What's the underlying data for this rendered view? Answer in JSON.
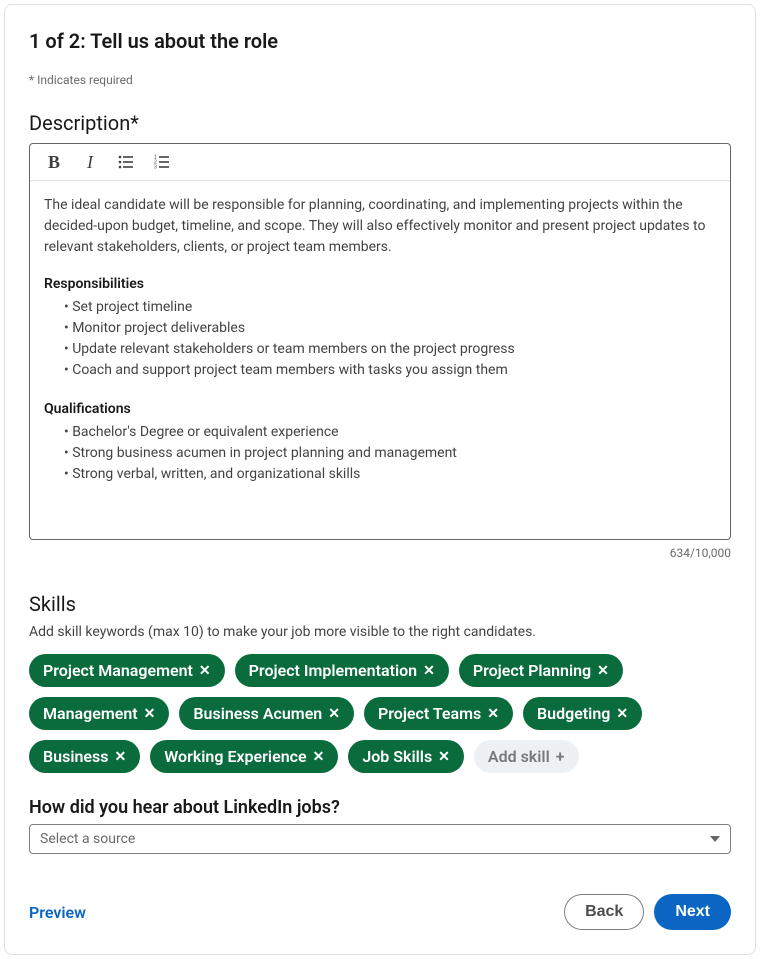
{
  "header": {
    "step_title": "1 of 2: Tell us about the role",
    "required_note": "* Indicates required"
  },
  "description": {
    "heading": "Description*",
    "intro": "The ideal candidate will be responsible for planning, coordinating, and implementing projects within the decided-upon budget, timeline, and scope. They will also effectively monitor and present project updates to relevant stakeholders, clients, or project team members.",
    "resp_heading": "Responsibilities",
    "responsibilities": [
      "Set project timeline",
      "Monitor project deliverables",
      "Update relevant stakeholders or team members on the project progress",
      "Coach and support project team members with tasks you assign them"
    ],
    "qual_heading": "Qualifications",
    "qualifications": [
      "Bachelor's Degree or equivalent experience",
      "Strong business acumen in project planning and management",
      "Strong verbal, written, and organizational skills"
    ],
    "char_count": "634/10,000"
  },
  "skills": {
    "heading": "Skills",
    "help": "Add skill keywords (max 10) to make your job more visible to the right candidates.",
    "items": [
      "Project Management",
      "Project Implementation",
      "Project Planning",
      "Management",
      "Business Acumen",
      "Project Teams",
      "Budgeting",
      "Business",
      "Working Experience",
      "Job Skills"
    ],
    "add_label": "Add skill"
  },
  "source": {
    "label": "How did you hear about LinkedIn jobs?",
    "placeholder": "Select a source"
  },
  "footer": {
    "preview": "Preview",
    "back": "Back",
    "next": "Next"
  }
}
